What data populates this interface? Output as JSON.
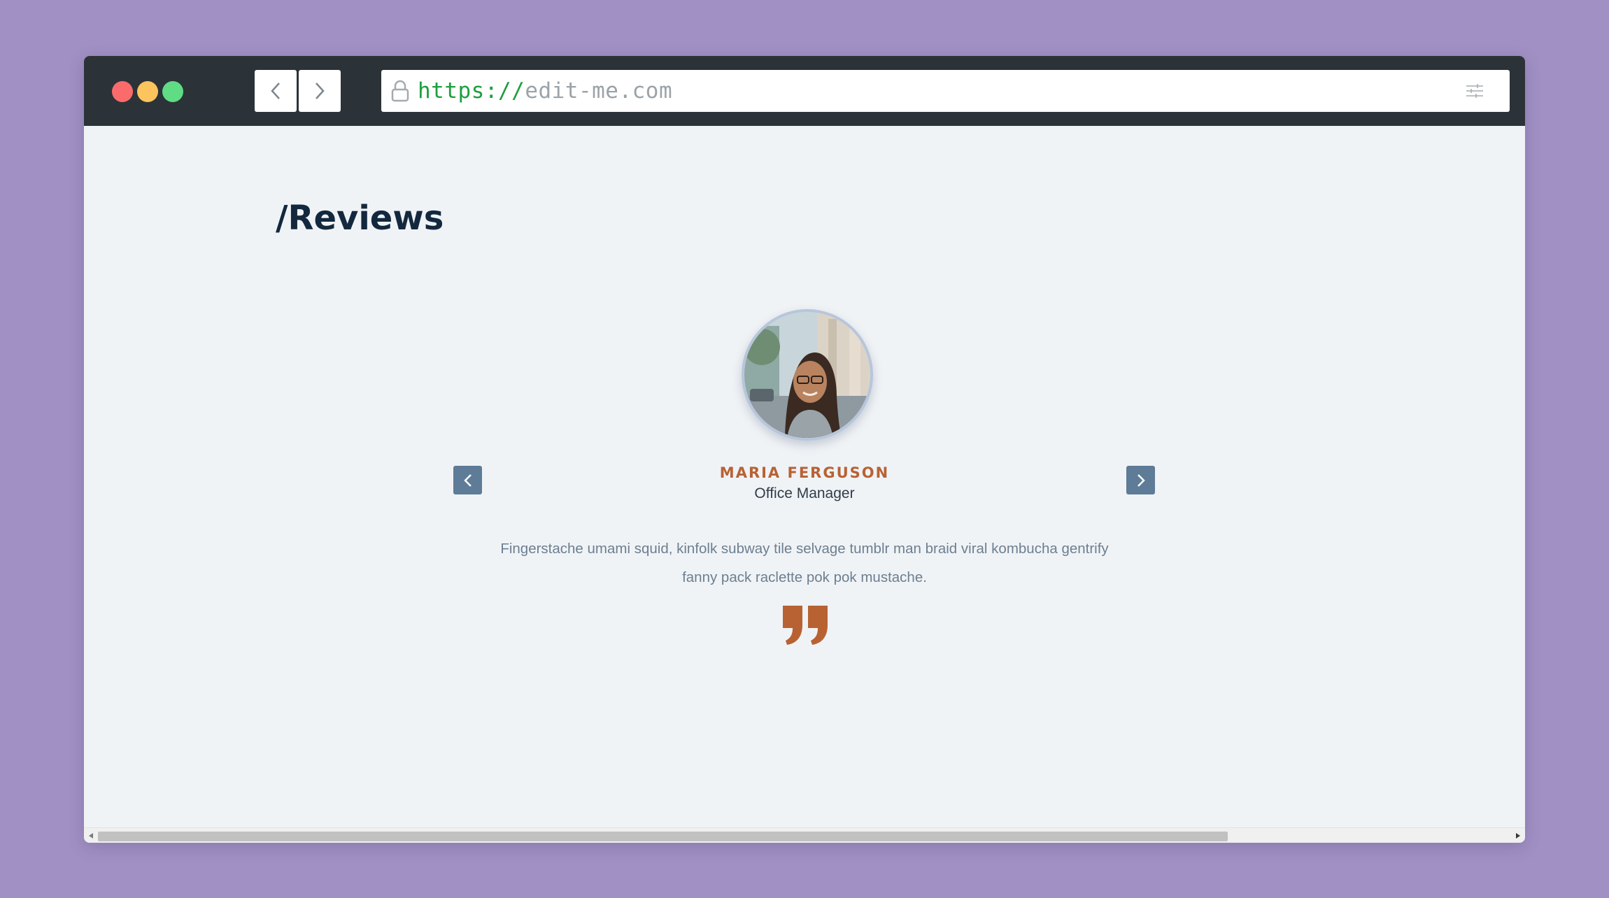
{
  "browser": {
    "url_scheme": "https://",
    "url_host": "edit-me.com"
  },
  "page": {
    "title": "/Reviews"
  },
  "review": {
    "name": "MARIA FERGUSON",
    "role": "Office Manager",
    "text": "Fingerstache umami squid, kinfolk subway tile selvage tumblr man braid viral kombucha gentrify fanny pack raclette pok pok mustache."
  },
  "colors": {
    "accent": "#b86234",
    "arrow_button": "#5e7b97",
    "title": "#13283e"
  },
  "icons": {
    "prev": "chevron-left-icon",
    "next": "chevron-right-icon",
    "quote": "quote-icon",
    "lock": "lock-icon",
    "settings": "sliders-icon"
  }
}
